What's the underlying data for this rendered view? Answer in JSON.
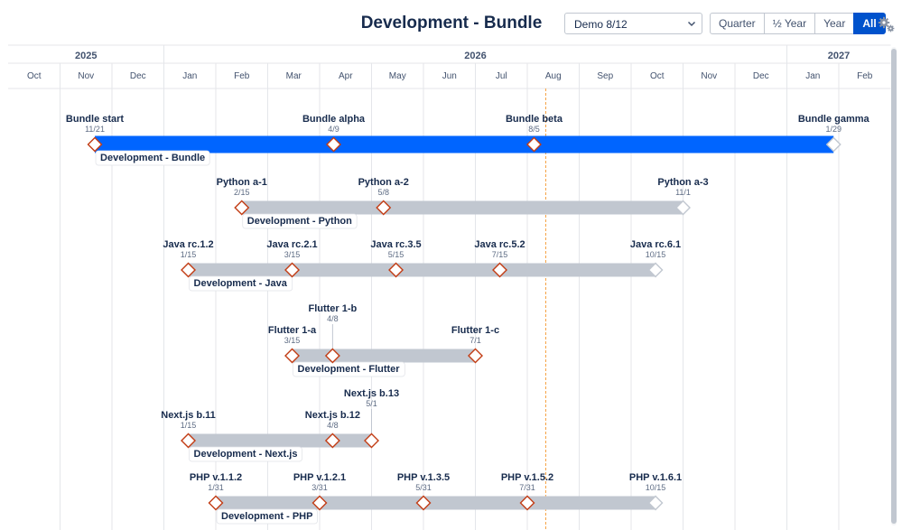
{
  "header": {
    "title": "Development - Bundle",
    "select": {
      "value": "Demo 8/12",
      "icon": "chevron-down-icon"
    },
    "range_buttons": [
      {
        "label": "Quarter",
        "active": false
      },
      {
        "label": "½ Year",
        "active": false
      },
      {
        "label": "Year",
        "active": false
      },
      {
        "label": "All",
        "active": true
      }
    ],
    "settings_icon": "gears-icon"
  },
  "timeline": {
    "years": [
      {
        "label": "2025",
        "start": 0,
        "end": 3
      },
      {
        "label": "2026",
        "start": 3,
        "end": 15
      },
      {
        "label": "2027",
        "start": 15,
        "end": 17
      }
    ],
    "months": [
      "Oct",
      "Nov",
      "Dec",
      "Jan",
      "Feb",
      "Mar",
      "Apr",
      "May",
      "Jun",
      "Jul",
      "Aug",
      "Sep",
      "Oct",
      "Nov",
      "Dec",
      "Jan",
      "Feb"
    ],
    "today": "8/12",
    "colors": {
      "primary_bar": "#0065ff",
      "bar": "#c1c7d0",
      "milestone_border": "#c23c14",
      "today_line": "#f59e3b",
      "grid": "#e4e6ea",
      "text": "#172b4d",
      "subtext": "#5e6c84"
    },
    "projects": [
      {
        "name": "Development - Bundle",
        "primary": true,
        "milestones": [
          {
            "label": "Bundle start",
            "date": "11/21",
            "m": 1.67
          },
          {
            "label": "Bundle alpha",
            "date": "4/9",
            "m": 6.27
          },
          {
            "label": "Bundle beta",
            "date": "8/5",
            "m": 10.13
          },
          {
            "label": "Bundle gamma",
            "date": "1/29",
            "m": 15.9,
            "end": true
          }
        ]
      },
      {
        "name": "Development - Python",
        "milestones": [
          {
            "label": "Python a-1",
            "date": "2/15",
            "m": 4.5
          },
          {
            "label": "Python a-2",
            "date": "5/8",
            "m": 7.23
          },
          {
            "label": "Python a-3",
            "date": "11/1",
            "m": 13.0,
            "end": true
          }
        ]
      },
      {
        "name": "Development - Java",
        "milestones": [
          {
            "label": "Java rc.1.2",
            "date": "1/15",
            "m": 3.47
          },
          {
            "label": "Java rc.2.1",
            "date": "3/15",
            "m": 5.47
          },
          {
            "label": "Java rc.3.5",
            "date": "5/15",
            "m": 7.47
          },
          {
            "label": "Java rc.5.2",
            "date": "7/15",
            "m": 9.47
          },
          {
            "label": "Java rc.6.1",
            "date": "10/15",
            "m": 12.47,
            "end": true
          }
        ]
      },
      {
        "name": "Development - Flutter",
        "milestones": [
          {
            "label": "Flutter 1-a",
            "date": "3/15",
            "m": 5.47
          },
          {
            "label": "Flutter 1-b",
            "date": "4/8",
            "m": 6.25,
            "raised": true
          },
          {
            "label": "Flutter 1-c",
            "date": "7/1",
            "m": 9.0
          }
        ]
      },
      {
        "name": "Development - Next.js",
        "milestones": [
          {
            "label": "Next.js b.11",
            "date": "1/15",
            "m": 3.47
          },
          {
            "label": "Next.js b.12",
            "date": "4/8",
            "m": 6.25
          },
          {
            "label": "Next.js b.13",
            "date": "5/1",
            "m": 7.0,
            "raised": true
          }
        ]
      },
      {
        "name": "Development - PHP",
        "milestones": [
          {
            "label": "PHP v.1.1.2",
            "date": "1/31",
            "m": 4.0
          },
          {
            "label": "PHP v.1.2.1",
            "date": "3/31",
            "m": 6.0
          },
          {
            "label": "PHP v.1.3.5",
            "date": "5/31",
            "m": 8.0
          },
          {
            "label": "PHP v.1.5.2",
            "date": "7/31",
            "m": 10.0
          },
          {
            "label": "PHP v.1.6.1",
            "date": "10/15",
            "m": 12.47,
            "end": true
          }
        ]
      }
    ]
  }
}
